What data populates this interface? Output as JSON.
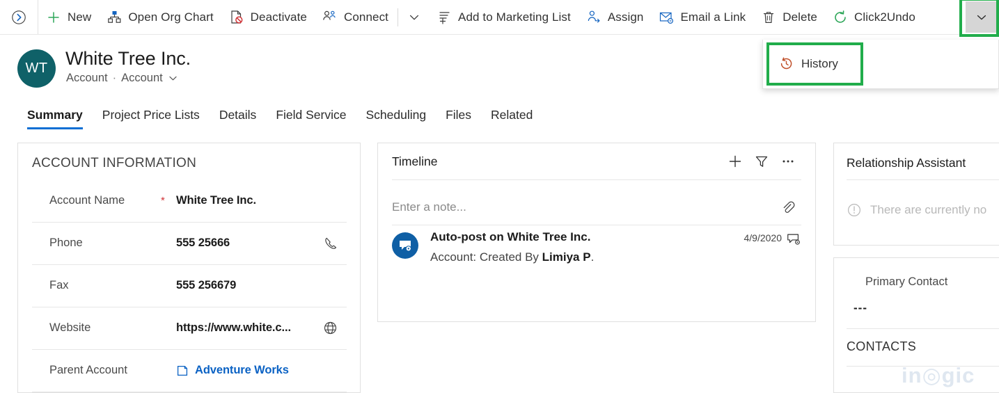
{
  "commandbar": {
    "expand_icon": "expand-right-circle-icon",
    "buttons": [
      {
        "label": "New",
        "icon": "plus-icon"
      },
      {
        "label": "Open Org Chart",
        "icon": "org-chart-icon"
      },
      {
        "label": "Deactivate",
        "icon": "deactivate-document-icon"
      },
      {
        "label": "Connect",
        "icon": "connect-people-icon"
      }
    ],
    "buttons2": [
      {
        "label": "Add to Marketing List",
        "icon": "add-to-list-icon"
      },
      {
        "label": "Assign",
        "icon": "assign-person-icon"
      },
      {
        "label": "Email a Link",
        "icon": "email-link-icon"
      },
      {
        "label": "Delete",
        "icon": "trash-icon"
      },
      {
        "label": "Click2Undo",
        "icon": "undo-circle-icon"
      }
    ],
    "inline_chevron_icon": "chevron-down-icon",
    "overflow_icon": "chevron-down-icon",
    "highlight_color": "#21ad4b"
  },
  "dropdown": {
    "items": [
      {
        "label": "History",
        "icon": "history-clock-icon"
      }
    ]
  },
  "record": {
    "avatar_initials": "WT",
    "avatar_color": "#0f6168",
    "title": "White Tree Inc.",
    "entity": "Account",
    "separator": "·",
    "form_name": "Account",
    "form_chevron_icon": "chevron-down-icon"
  },
  "tabs": [
    {
      "label": "Summary",
      "active": true
    },
    {
      "label": "Project Price Lists",
      "active": false
    },
    {
      "label": "Details",
      "active": false
    },
    {
      "label": "Field Service",
      "active": false
    },
    {
      "label": "Scheduling",
      "active": false
    },
    {
      "label": "Files",
      "active": false
    },
    {
      "label": "Related",
      "active": false
    }
  ],
  "account_information": {
    "section_title": "ACCOUNT INFORMATION",
    "fields": [
      {
        "label": "Account Name",
        "required": "*",
        "value": "White Tree Inc.",
        "icon": "",
        "link": false
      },
      {
        "label": "Phone",
        "required": "",
        "value": "555 25666",
        "icon": "phone-icon",
        "link": false
      },
      {
        "label": "Fax",
        "required": "",
        "value": "555 256679",
        "icon": "",
        "link": false
      },
      {
        "label": "Website",
        "required": "",
        "value": "https://www.white.c...",
        "icon": "globe-icon",
        "link": false
      },
      {
        "label": "Parent Account",
        "required": "",
        "value": "Adventure Works",
        "icon": "lookup-record-icon",
        "link": true
      }
    ]
  },
  "timeline": {
    "title": "Timeline",
    "actions": [
      {
        "icon": "plus-icon",
        "name": "create-timeline-record-button"
      },
      {
        "icon": "filter-icon",
        "name": "filter-timeline-button"
      },
      {
        "icon": "more-ellipsis-icon",
        "name": "timeline-more-commands-button"
      }
    ],
    "note_placeholder": "Enter a note...",
    "attach_icon": "paperclip-icon",
    "posts": [
      {
        "avatar_icon": "auto-post-bubble-icon",
        "title": "Auto-post on White Tree Inc.",
        "detail_prefix": "Account: Created By ",
        "detail_bold": "Limiya P",
        "detail_suffix": ".",
        "date": "4/9/2020",
        "type_icon": "post-bubble-icon"
      }
    ]
  },
  "relationship_assistant": {
    "title": "Relationship Assistant",
    "empty_icon": "info-circle-icon",
    "empty_text": "There are currently no"
  },
  "contacts_card": {
    "primary_contact_label": "Primary Contact",
    "primary_contact_value": "---",
    "section_title": "CONTACTS"
  },
  "watermark": {
    "text_before": "in",
    "text_mid": "◎",
    "text_after": "gic"
  }
}
